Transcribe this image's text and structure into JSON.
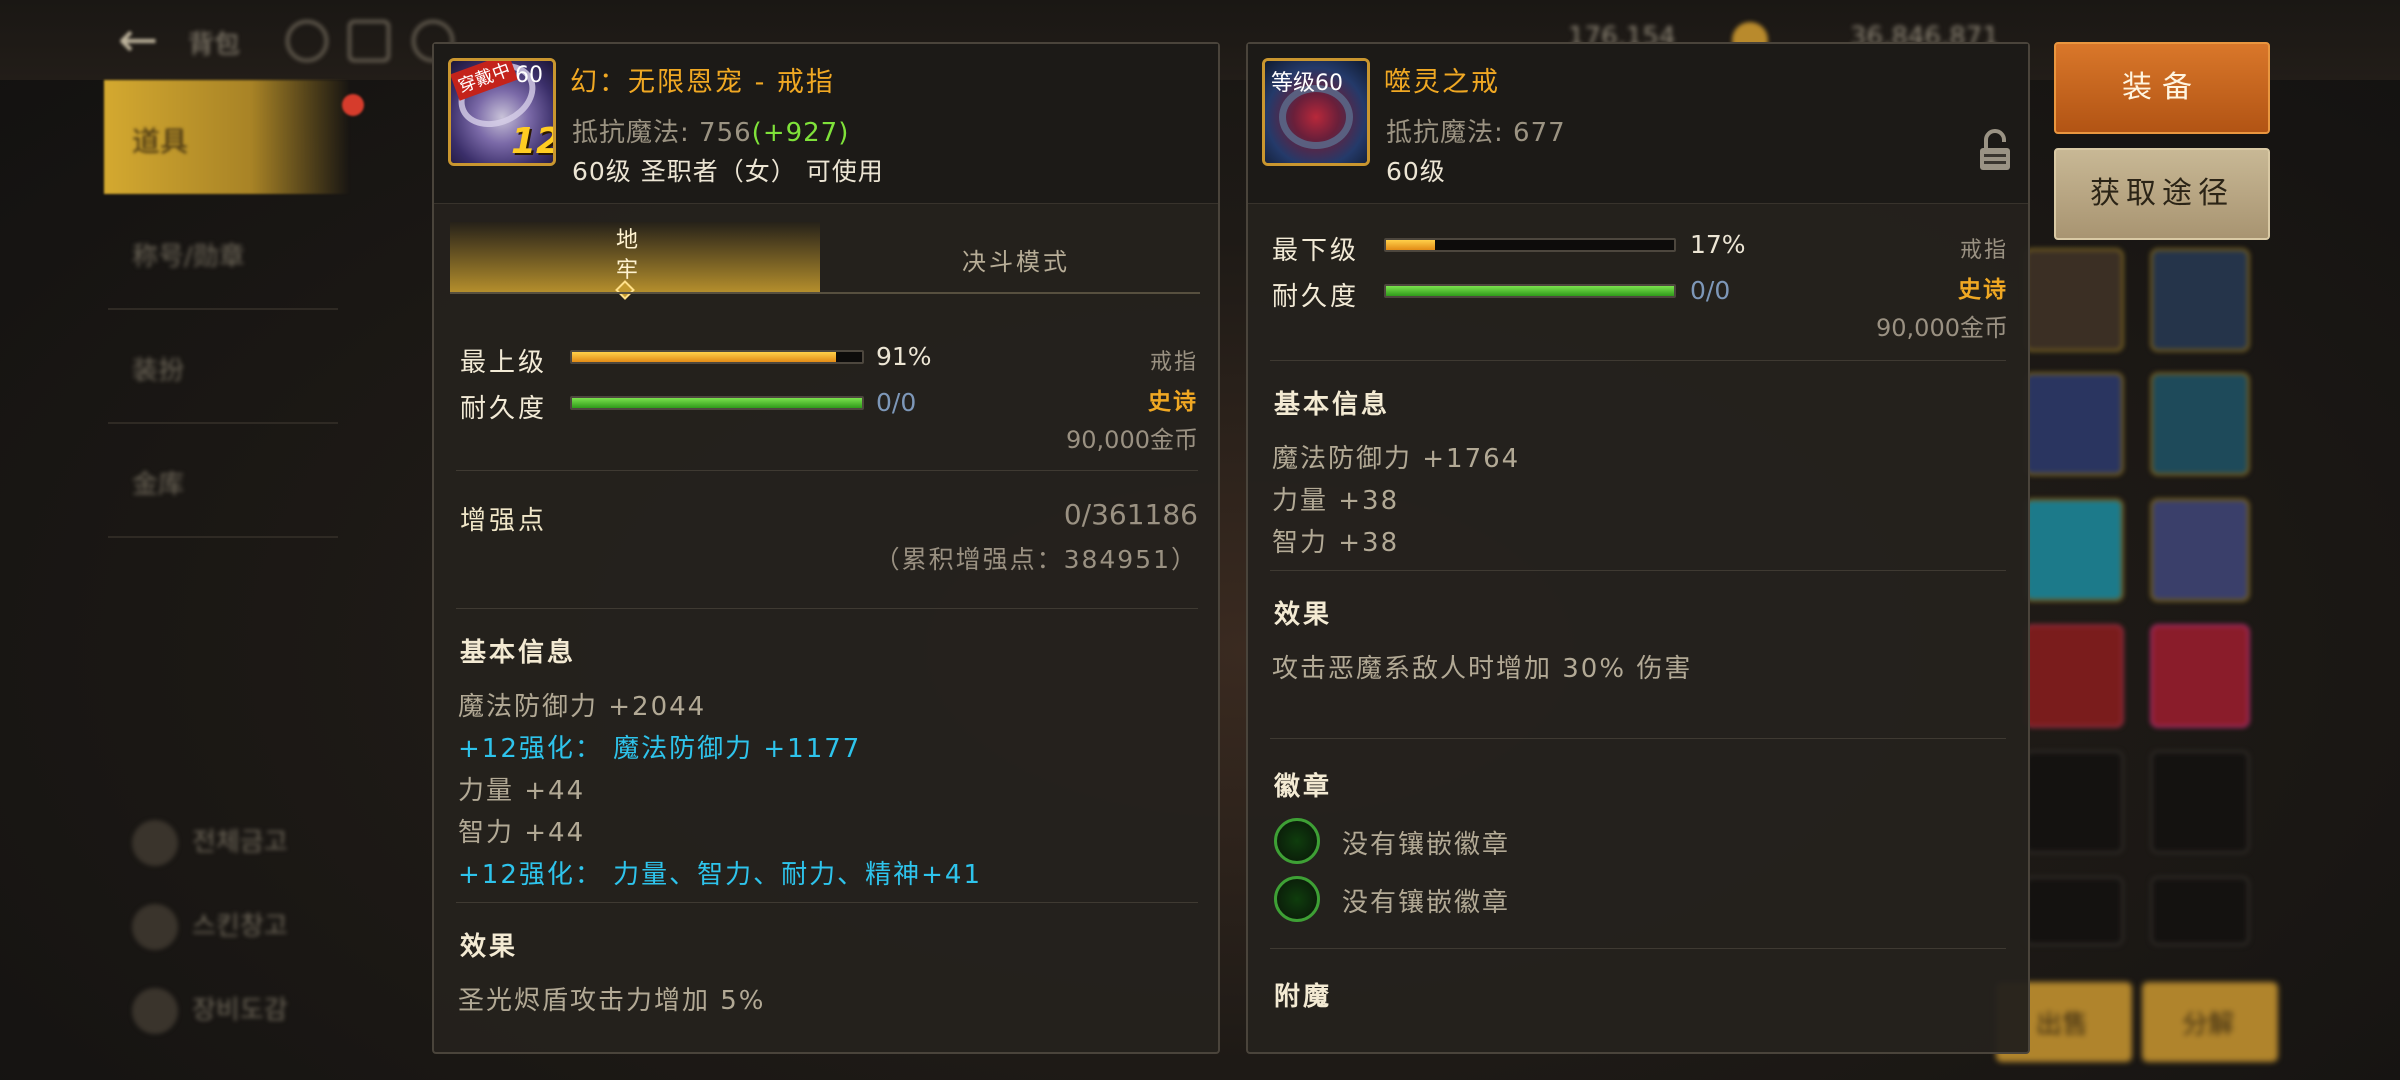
{
  "background": {
    "title": "背包",
    "sidebar": {
      "active": "道具",
      "items": [
        "称号/勋章",
        "装扮",
        "金库"
      ],
      "bottom_items": [
        "전체금고",
        "스킨창고",
        "장비도감"
      ]
    },
    "top_values": [
      "176,154",
      "36,846,871"
    ],
    "bottom_buttons": [
      "出售",
      "分解"
    ]
  },
  "left_panel": {
    "item_name": "幻：无限恩宠 - 戒指",
    "icon_badge": "穿戴中",
    "icon_level": "60",
    "icon_enhance": "12",
    "resist_label": "抵抗魔法:",
    "resist_base": "756",
    "resist_bonus": "(+927)",
    "level_req": "60级 圣职者（女） 可使用",
    "tabs": {
      "active_label": "地牢",
      "active_label_chars": [
        "地",
        "牢"
      ],
      "inactive_label": "决斗模式"
    },
    "grade": {
      "label": "最上级",
      "percent": 91,
      "value": "91%"
    },
    "durability": {
      "label": "耐久度",
      "percent": 100,
      "value": "0/0"
    },
    "item_type": "戒指",
    "rarity": "史诗",
    "price": "90,000金币",
    "enhance_points": {
      "label": "增强点",
      "value": "0/361186",
      "accumulated": "（累积增强点：384951）"
    },
    "basic_info_title": "基本信息",
    "basic_info": [
      {
        "text": "魔法防御力 +2044",
        "style": "gray"
      },
      {
        "text": "+12强化： 魔法防御力 +1177",
        "style": "blue"
      },
      {
        "text": "力量 +44",
        "style": "gray"
      },
      {
        "text": "智力 +44",
        "style": "gray"
      },
      {
        "text": "+12强化： 力量、智力、耐力、精神+41",
        "style": "blue"
      }
    ],
    "effect_title": "效果",
    "effect_text": "圣光烬盾攻击力增加 5%"
  },
  "right_panel": {
    "item_name": "噬灵之戒",
    "icon_level_label": "等级60",
    "resist_label": "抵抗魔法:",
    "resist_base": "677",
    "level_req": "60级",
    "grade": {
      "label": "最下级",
      "percent": 17,
      "value": "17%"
    },
    "durability": {
      "label": "耐久度",
      "percent": 100,
      "value": "0/0"
    },
    "item_type": "戒指",
    "rarity": "史诗",
    "price": "90,000金币",
    "basic_info_title": "基本信息",
    "basic_info": [
      "魔法防御力 +1764",
      "力量 +38",
      "智力 +38"
    ],
    "effect_title": "效果",
    "effect_text": "攻击恶魔系敌人时增加 30% 伤害",
    "emblem_title": "徽章",
    "emblems": [
      "没有镶嵌徽章",
      "没有镶嵌徽章"
    ],
    "enchant_title": "附魔"
  },
  "buttons": {
    "equip": "装备",
    "source": "获取途径"
  },
  "colors": {
    "gold": "#f0a823",
    "blue_stat": "#2ec4ec",
    "bonus_green": "#7fe23a",
    "equip_orange": "#c9661e"
  }
}
